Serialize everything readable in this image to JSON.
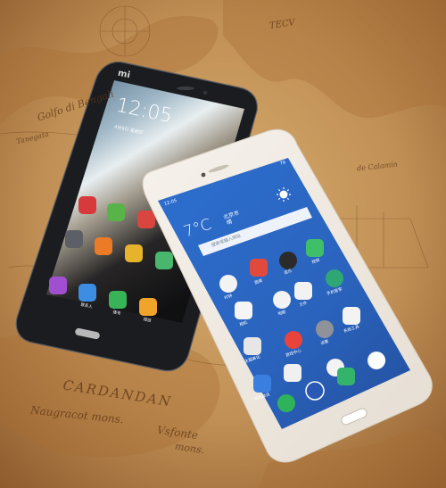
{
  "map": {
    "labels": [
      {
        "id": "tecv",
        "text": "TECV"
      },
      {
        "id": "golfo",
        "text": "Golfo di Bengali"
      },
      {
        "id": "tanegata",
        "text": "Tanegata"
      },
      {
        "id": "calamin",
        "text": "de Calamin"
      },
      {
        "id": "cardandan",
        "text": "CARDANDAN"
      },
      {
        "id": "naugracot",
        "text": "Naugracot mons."
      },
      {
        "id": "vsonte",
        "text": "Vsfonte"
      },
      {
        "id": "mons",
        "text": "mons."
      }
    ]
  },
  "xiaomi_phone": {
    "brand_logo": "mi",
    "clock_time": "12:05",
    "clock_date": "4月9日 星期四",
    "dock_labels": [
      "",
      "联系人",
      "拨号",
      "短信"
    ]
  },
  "meizu_phone": {
    "status_time": "12:05",
    "status_battery": "76",
    "weather": {
      "temperature": "7°C",
      "city": "北京市",
      "condition": "晴"
    },
    "search_placeholder": "搜索或输入网址",
    "app_labels": [
      "时钟",
      "图库",
      "音乐",
      "视频",
      "相机",
      "地图",
      "文件",
      "手机管家",
      "主题美化",
      "游戏中心",
      "设置",
      "系统工具",
      "应用商店",
      "",
      "",
      ""
    ]
  },
  "colors": {
    "map_base": "#c89a5c",
    "meizu_screen": "#2b69c6",
    "xiaomi_body": "#191a1d"
  }
}
